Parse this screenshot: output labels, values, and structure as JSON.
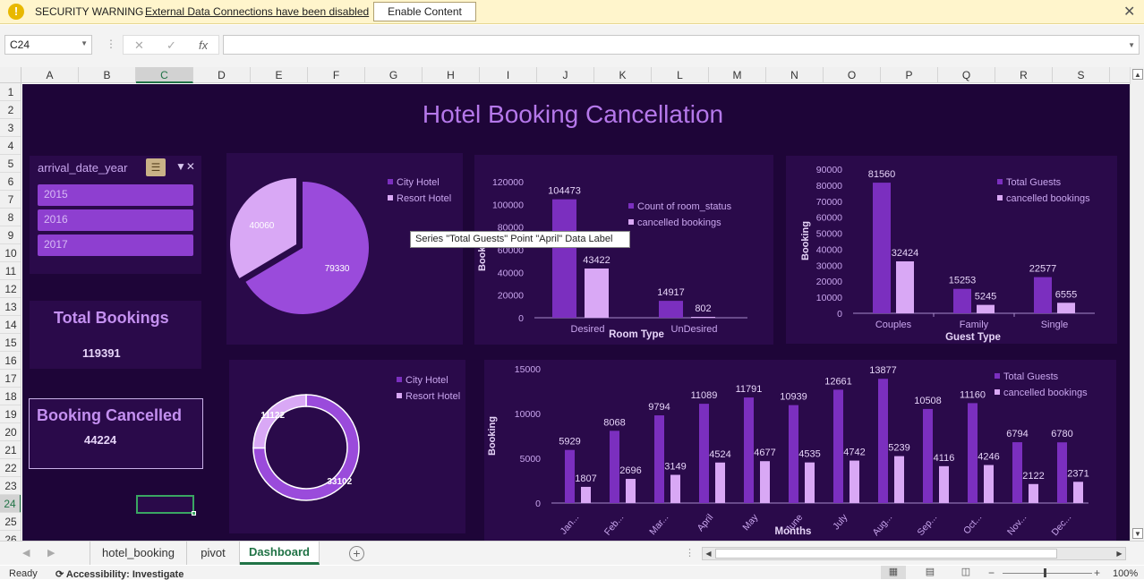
{
  "security_bar": {
    "title": "SECURITY WARNING",
    "message": "External Data Connections have been disabled",
    "button": "Enable Content"
  },
  "formula_bar": {
    "name_box": "C24",
    "formula": ""
  },
  "columns": [
    "A",
    "B",
    "C",
    "D",
    "E",
    "F",
    "G",
    "H",
    "I",
    "J",
    "K",
    "L",
    "M",
    "N",
    "O",
    "P",
    "Q",
    "R",
    "S"
  ],
  "rows": [
    "1",
    "2",
    "3",
    "4",
    "5",
    "6",
    "7",
    "8",
    "9",
    "10",
    "11",
    "12",
    "13",
    "14",
    "15",
    "16",
    "17",
    "18",
    "19",
    "20",
    "21",
    "22",
    "23",
    "24",
    "25",
    "26"
  ],
  "selected_cell": {
    "column": "C",
    "row": "24"
  },
  "dashboard": {
    "title": "Hotel Booking  Cancellation",
    "slicer": {
      "header": "arrival_date_year",
      "items": [
        "2015",
        "2016",
        "2017"
      ]
    },
    "kpi_total": {
      "title": "Total Bookings",
      "value": "119391"
    },
    "kpi_cancelled": {
      "title": "Booking  Cancelled",
      "value": "44224"
    },
    "tooltip": "Series \"Total Guests\" Point \"April\" Data Label"
  },
  "colors": {
    "accent": "#7b2fbf",
    "light": "#d9a8f5",
    "background": "#1e0538",
    "panel": "#2a0a4a",
    "title": "#b578ea"
  },
  "chart_data": [
    {
      "type": "pie",
      "categories": [
        "City Hotel",
        "Resort Hotel"
      ],
      "values": [
        79330,
        40060
      ],
      "legend": "top-right"
    },
    {
      "type": "bar",
      "xlabel": "Room Type",
      "ylabel": "Booking",
      "categories": [
        "Desired",
        "UnDesired"
      ],
      "series": [
        {
          "name": "Count of room_status",
          "values": [
            104473,
            14917
          ]
        },
        {
          "name": "cancelled bookings",
          "values": [
            43422,
            802
          ]
        }
      ],
      "ylim": [
        0,
        120000
      ],
      "yticks": [
        "0",
        "20000",
        "40000",
        "60000",
        "80000",
        "100000",
        "120000"
      ],
      "legend": "top-right"
    },
    {
      "type": "bar",
      "xlabel": "Guest Type",
      "ylabel": "Booking",
      "categories": [
        "Couples",
        "Family",
        "Single"
      ],
      "series": [
        {
          "name": "Total Guests",
          "values": [
            81560,
            15253,
            22577
          ]
        },
        {
          "name": "cancelled bookings",
          "values": [
            32424,
            5245,
            6555
          ]
        }
      ],
      "ylim": [
        0,
        90000
      ],
      "yticks": [
        "0",
        "10000",
        "20000",
        "30000",
        "40000",
        "50000",
        "60000",
        "70000",
        "80000",
        "90000"
      ],
      "legend": "top-right"
    },
    {
      "type": "pie",
      "donut": true,
      "categories": [
        "City Hotel",
        "Resort Hotel"
      ],
      "values": [
        33102,
        11122
      ],
      "legend": "top-right"
    },
    {
      "type": "bar",
      "xlabel": "Months",
      "ylabel": "Booking",
      "categories": [
        "Jan...",
        "Feb...",
        "Mar...",
        "April",
        "May",
        "June",
        "July",
        "Aug...",
        "Sep...",
        "Oct...",
        "Nov...",
        "Dec..."
      ],
      "series": [
        {
          "name": "Total Guests",
          "values": [
            5929,
            8068,
            9794,
            11089,
            11791,
            10939,
            12661,
            13877,
            10508,
            11160,
            6794,
            6780
          ]
        },
        {
          "name": "cancelled bookings",
          "values": [
            1807,
            2696,
            3149,
            4524,
            4677,
            4535,
            4742,
            5239,
            4116,
            4246,
            2122,
            2371
          ]
        }
      ],
      "ylim": [
        0,
        15000
      ],
      "yticks": [
        "0",
        "5000",
        "10000",
        "15000"
      ],
      "legend": "top-right"
    }
  ],
  "tabs": [
    "hotel_booking",
    "pivot",
    "Dashboard"
  ],
  "active_tab": "Dashboard",
  "status": {
    "ready": "Ready",
    "accessibility": "Accessibility: Investigate",
    "zoom": "100%"
  }
}
